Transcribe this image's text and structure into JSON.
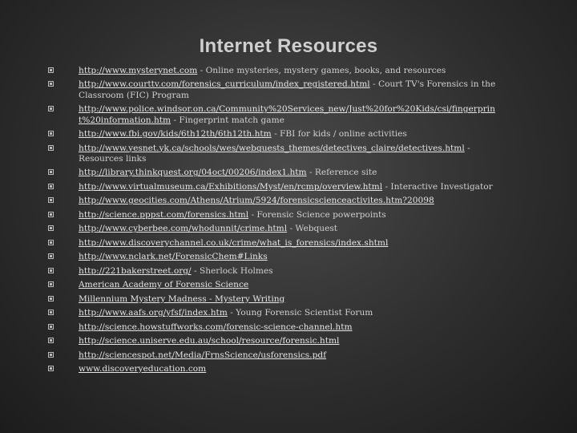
{
  "slide": {
    "title": "Internet Resources",
    "items": [
      {
        "link": "http://www.mysterynet.com",
        "desc": " - Online mysteries, mystery games, books, and resources"
      },
      {
        "link": "http://www.courttv.com/forensics_curriculum/index_registered.html",
        "desc": " - Court TV's Forensics in the Classroom (FIC) Program"
      },
      {
        "link": "http://www.police.windsor.on.ca/Community%20Services_new/Just%20for%20Kids/csi/fingerprint%20information.htm",
        "desc": " - Fingerprint match game"
      },
      {
        "link": "http://www.fbi.gov/kids/6th12th/6th12th.htm",
        "desc": " - FBI for kids / online activities"
      },
      {
        "link": "http://www.yesnet.yk.ca/schools/wes/webquests_themes/detectives_claire/detectives.html",
        "desc": " - Resources links"
      },
      {
        "link": "http://library.thinkquest.org/04oct/00206/index1.htm",
        "desc": " - Reference site"
      },
      {
        "link": "http://www.virtualmuseum.ca/Exhibitions/Myst/en/rcmp/overview.html",
        "desc": " - Interactive Investigator"
      },
      {
        "link": "http://www.geocities.com/Athens/Atrium/5924/forensicscienceactivites.htm?20098",
        "desc": ""
      },
      {
        "link": "http://science.pppst.com/forensics.html",
        "desc": " - Forensic Science powerpoints"
      },
      {
        "link": "http://www.cyberbee.com/whodunnit/crime.html",
        "desc": " - Webquest"
      },
      {
        "link": "http://www.discoverychannel.co.uk/crime/what_is_forensics/index.shtml",
        "desc": ""
      },
      {
        "link": "http://www.nclark.net/ForensicChem#Links",
        "desc": ""
      },
      {
        "link": "http://221bakerstreet.org/",
        "desc": " - Sherlock Holmes"
      },
      {
        "link": "American Academy of Forensic Science",
        "desc": ""
      },
      {
        "link": "Millennium Mystery Madness - Mystery Writing",
        "desc": ""
      },
      {
        "link": "http://www.aafs.org/yfsf/index.htm",
        "desc": " - Young Forensic Scientist Forum"
      },
      {
        "link": "http://science.howstuffworks.com/forensic-science-channel.htm",
        "desc": ""
      },
      {
        "link": "http://science.uniserve.edu.au/school/resource/forensic.html",
        "desc": ""
      },
      {
        "link": "http://sciencespot.net/Media/FrnsScience/usforensics.pdf",
        "desc": ""
      },
      {
        "link": "www.discoveryeducation.com",
        "desc": ""
      }
    ]
  },
  "colors": {
    "background": "#2e2e2e",
    "text": "#d9d9d9",
    "title": "#cfcfcf"
  },
  "icons": {
    "bullet": "square-bullet-icon"
  }
}
